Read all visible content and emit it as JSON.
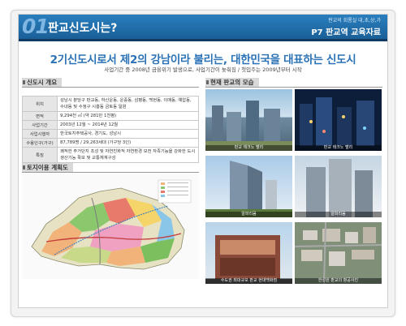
{
  "header": {
    "number": "01",
    "title": "판교신도시는?",
    "subtitle_small": "판교의 회룡실 대,초,상,가",
    "subtitle": "P7 판교역 교육자료"
  },
  "headline": "2기신도시로서 제2의 강남이라 불리는, 대한민국을 대표하는 신도시",
  "sub_headline": "사업기간 중 2008년 금융위기 발생으로, 사업기간이 늦춰짐 / 첫입주는 2009년부터 시작",
  "overview": {
    "title": "신도시 개요",
    "rows": [
      {
        "key": "위치",
        "value": "성남시 분당구 판교동, 하산운동, 운중동, 삼평동, 백현동, 이매동, 예압동, 수내동 및 수정구 시흥동 금토동 일원"
      },
      {
        "key": "면적",
        "value": "9,294천 ㎡ (약 281만 1천평)"
      },
      {
        "key": "사업기간",
        "value": "2003년 12월 ~ 2014년 12월"
      },
      {
        "key": "사업시행자",
        "value": "한국토지주택공사, 경기도, 성남시"
      },
      {
        "key": "수용인구(가구)",
        "value": "87,789명 / 29,263세대 (가구당 3인)"
      },
      {
        "key": "특징",
        "value": "쾌적한 주거단지 조성 및 자연친화적 자연환경 보전 자족기능을 강화한 도시생산기능 확보 및 교통체계구성"
      }
    ]
  },
  "landuse": {
    "title": "토지이용 계획도"
  },
  "current": {
    "title": "현재 판교의 모습",
    "photos": [
      {
        "caption": "판교 테크노 밸리"
      },
      {
        "caption": "판교 테크노 밸리"
      },
      {
        "caption": "알파리움"
      },
      {
        "caption": "알파리움"
      },
      {
        "caption": "수도권 최대규모 판교 현대백화점"
      },
      {
        "caption": "한성원 판교의 항공사진"
      }
    ]
  }
}
